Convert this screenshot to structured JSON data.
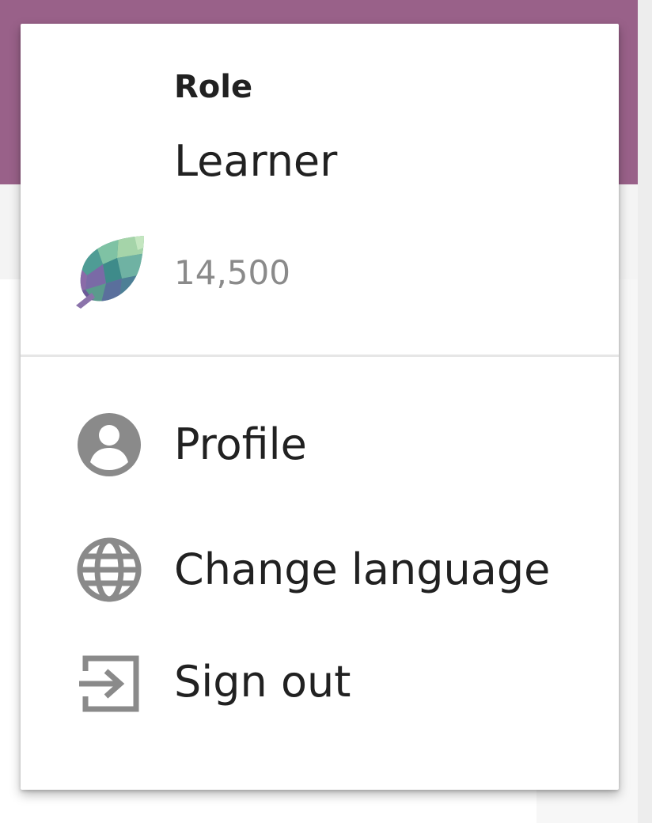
{
  "user_menu": {
    "role_heading": "Role",
    "role_value": "Learner",
    "points": "14,500",
    "points_icon": "points-leaf-icon",
    "items": [
      {
        "label": "Profile",
        "icon": "person-circle-icon"
      },
      {
        "label": "Change language",
        "icon": "globe-icon"
      },
      {
        "label": "Sign out",
        "icon": "logout-icon"
      }
    ]
  },
  "colors": {
    "app_bar": "#996189",
    "icon_gray": "#8a8a8a",
    "text_primary": "#212121"
  }
}
